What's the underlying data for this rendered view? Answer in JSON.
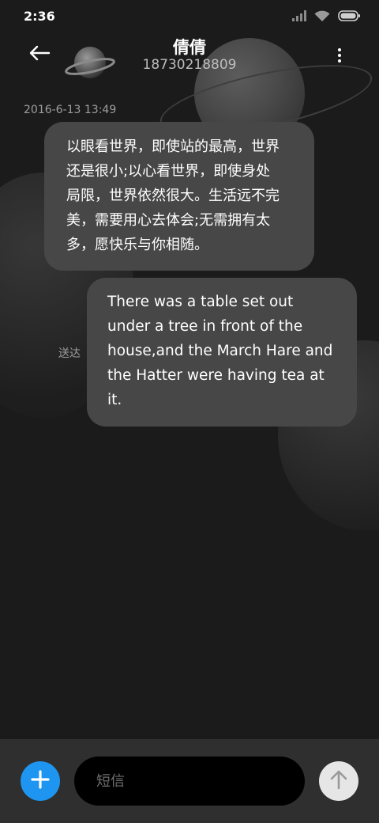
{
  "status_bar": {
    "time": "2:36",
    "icons": [
      "signal-icon",
      "wifi-icon",
      "battery-icon"
    ]
  },
  "header": {
    "back_icon": "arrow-left-icon",
    "avatar_icon": "planet-avatar-icon",
    "contact_name": "倩倩",
    "contact_number": "18730218809",
    "more_icon": "more-vertical-icon"
  },
  "conversation": {
    "timestamp": "2016-6-13 13:49",
    "messages": [
      {
        "direction": "incoming",
        "lines": [
          "以眼看世界，即使站的最高，世界",
          "还是很小;以心看世界，即使身处",
          "局限，世界依然很大。生活远不完",
          "美，需要用心去体会;无需拥有太",
          "多，愿快乐与你相随。"
        ]
      },
      {
        "direction": "outgoing",
        "status": "送达",
        "lines": [
          "There was a table set out",
          "under a tree in front of the",
          "house,and the March Hare and",
          "the Hatter were having tea at",
          "it."
        ]
      }
    ]
  },
  "compose": {
    "add_icon": "plus-icon",
    "placeholder": "短信",
    "value": "",
    "send_icon": "arrow-up-icon"
  },
  "colors": {
    "background": "#1b1b1b",
    "bubble": "#474747",
    "accent": "#1e95f0",
    "send_button": "#e6e6e6",
    "compose_bar": "#2f2f2f"
  }
}
